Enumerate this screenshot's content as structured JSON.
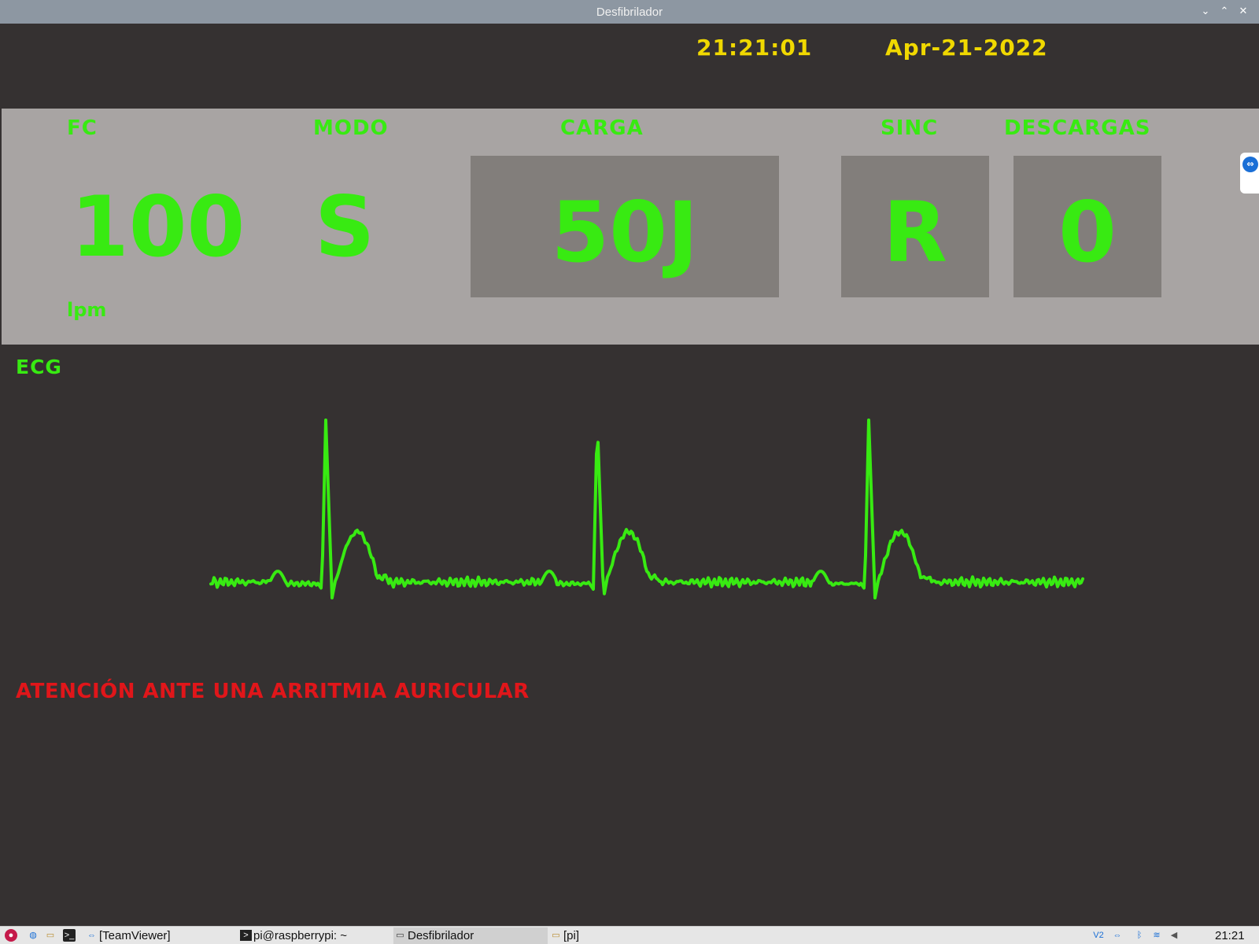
{
  "window": {
    "title": "Desfibrilador",
    "controls": {
      "minimize": "⌄",
      "maximize": "⌃",
      "close": "✕"
    }
  },
  "header": {
    "time": "21:21:01",
    "date": "Apr-21-2022"
  },
  "panel": {
    "fc_label": "FC",
    "fc_value": "100",
    "fc_unit": "lpm",
    "modo_label": "MODO",
    "modo_value": "S",
    "carga_label": "CARGA",
    "carga_value": "50J",
    "sinc_label": "SINC",
    "sinc_value": "R",
    "descargas_label": "DESCARGAS",
    "descargas_value": "0"
  },
  "ecg": {
    "label": "ECG",
    "trace_color": "#38ea12",
    "beats": 3
  },
  "alert": {
    "text": "ATENCIÓN ANTE UNA ARRITMIA AURICULAR",
    "color": "#e0161a"
  },
  "taskbar": {
    "tasks": [
      {
        "label": "[TeamViewer]",
        "icon": "teamviewer-icon"
      },
      {
        "label": "pi@raspberrypi: ~",
        "icon": "terminal-icon"
      },
      {
        "label": "Desfibrilador",
        "icon": "window-icon",
        "active": true
      },
      {
        "label": "[pi]",
        "icon": "folder-icon"
      }
    ],
    "clock": "21:21"
  },
  "colors": {
    "accent_green": "#38ea12",
    "clock_yellow": "#f0d800",
    "panel_bg": "#a8a4a3",
    "box_bg": "#827e7b",
    "screen_bg": "#353131"
  }
}
